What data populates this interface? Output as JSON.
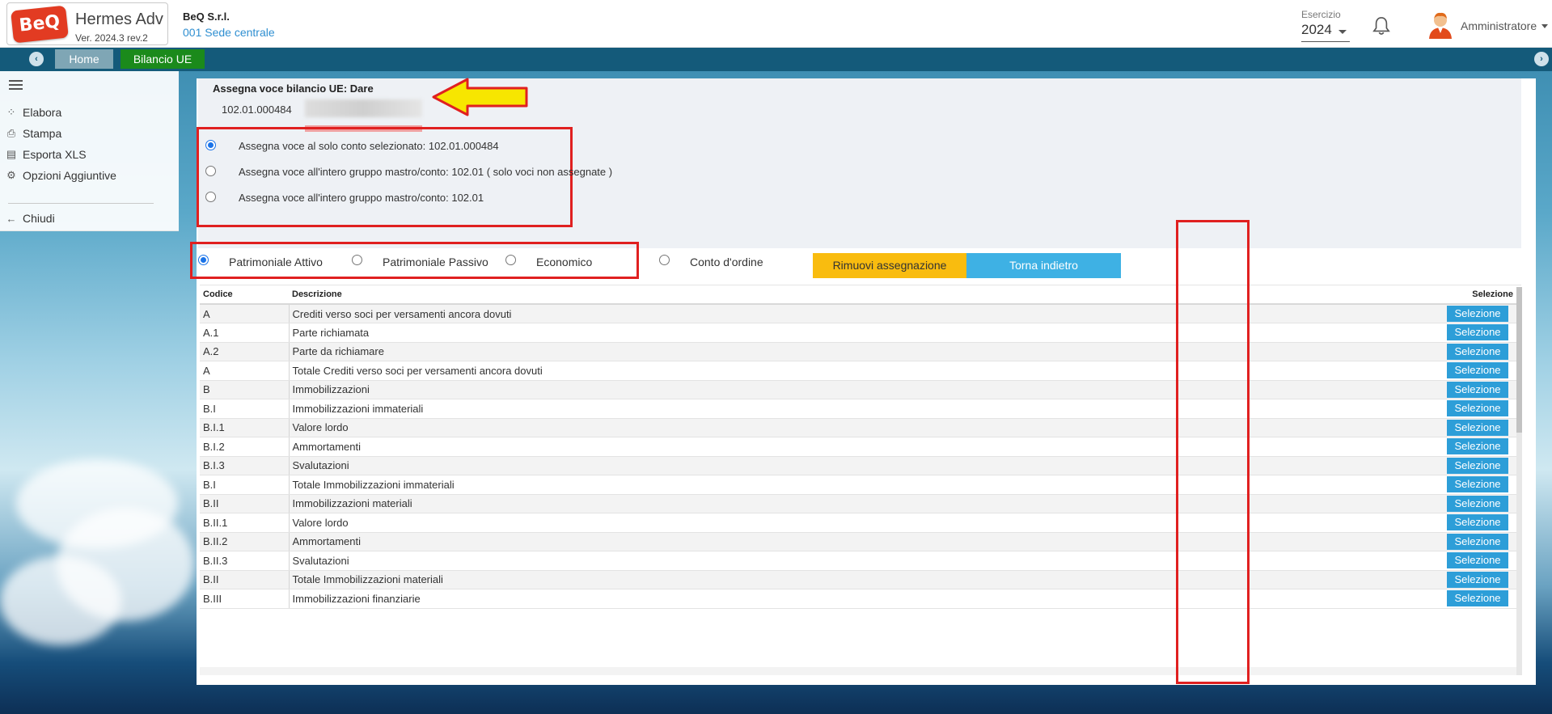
{
  "app": {
    "logo_text": "BeQ",
    "name": "Hermes Adv",
    "version": "Ver. 2024.3 rev.2",
    "company": "BeQ S.r.l.",
    "site": "001 Sede centrale"
  },
  "header": {
    "esercizio_label": "Esercizio",
    "esercizio_value": "2024",
    "user_name": "Amministratore"
  },
  "tabs": {
    "home": "Home",
    "active": "Bilancio UE"
  },
  "sidebar": {
    "items": [
      {
        "label": "Elabora",
        "icon": "spinner-icon"
      },
      {
        "label": "Stampa",
        "icon": "print-icon"
      },
      {
        "label": "Esporta XLS",
        "icon": "file-excel-icon"
      },
      {
        "label": "Opzioni Aggiuntive",
        "icon": "gears-icon"
      },
      {
        "label": "Chiudi",
        "icon": "arrow-left-icon"
      }
    ]
  },
  "form": {
    "title": "Assegna voce bilancio UE: Dare",
    "account_code": "102.01.000484",
    "scope_options": [
      {
        "label": "Assegna voce al solo conto selezionato: 102.01.000484",
        "checked": true
      },
      {
        "label": "Assegna voce all'intero gruppo mastro/conto: 102.01 ( solo voci non assegnate )",
        "checked": false
      },
      {
        "label": "Assegna voce all'intero gruppo mastro/conto: 102.01",
        "checked": false
      }
    ],
    "type_options": [
      {
        "label": "Patrimoniale Attivo",
        "checked": true
      },
      {
        "label": "Patrimoniale Passivo",
        "checked": false
      },
      {
        "label": "Economico",
        "checked": false
      },
      {
        "label": "Conto d'ordine",
        "checked": false
      }
    ],
    "remove_button": "Rimuovi assegnazione",
    "back_button": "Torna indietro"
  },
  "table": {
    "columns": {
      "codice": "Codice",
      "descrizione": "Descrizione",
      "selezione": "Selezione"
    },
    "select_label": "Selezione",
    "rows": [
      {
        "code": "A",
        "desc": "Crediti verso soci per versamenti ancora dovuti"
      },
      {
        "code": "A.1",
        "desc": "Parte richiamata"
      },
      {
        "code": "A.2",
        "desc": "Parte da richiamare"
      },
      {
        "code": "A",
        "desc": "Totale Crediti verso soci per versamenti ancora dovuti"
      },
      {
        "code": "B",
        "desc": "Immobilizzazioni"
      },
      {
        "code": "B.I",
        "desc": "Immobilizzazioni immateriali"
      },
      {
        "code": "B.I.1",
        "desc": "Valore lordo"
      },
      {
        "code": "B.I.2",
        "desc": "Ammortamenti"
      },
      {
        "code": "B.I.3",
        "desc": "Svalutazioni"
      },
      {
        "code": "B.I",
        "desc": "Totale Immobilizzazioni immateriali"
      },
      {
        "code": "B.II",
        "desc": "Immobilizzazioni materiali"
      },
      {
        "code": "B.II.1",
        "desc": "Valore lordo"
      },
      {
        "code": "B.II.2",
        "desc": "Ammortamenti"
      },
      {
        "code": "B.II.3",
        "desc": "Svalutazioni"
      },
      {
        "code": "B.II",
        "desc": "Totale Immobilizzazioni materiali"
      },
      {
        "code": "B.III",
        "desc": "Immobilizzazioni finanziarie"
      }
    ]
  },
  "colors": {
    "tabbar": "#145a7a",
    "active_tab": "#1b8a1b",
    "remove_button": "#f9bc0f",
    "back_button": "#3eb1e4",
    "select_button": "#2d9ed8",
    "highlight_red": "#e02020"
  }
}
